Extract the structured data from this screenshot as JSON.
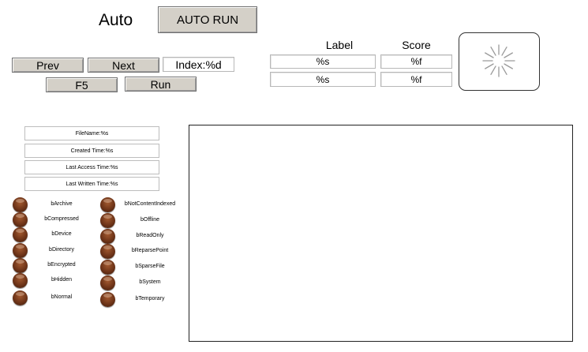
{
  "header": {
    "mode_title": "Auto",
    "auto_run_label": "AUTO RUN"
  },
  "nav": {
    "prev_label": "Prev",
    "next_label": "Next",
    "index_value": "Index:%d",
    "f5_label": "F5",
    "run_label": "Run"
  },
  "results": {
    "label_header": "Label",
    "score_header": "Score",
    "rows": [
      {
        "label": "%s",
        "score": "%f"
      },
      {
        "label": "%s",
        "score": "%f"
      }
    ]
  },
  "file_info": {
    "file_name": "FileName:%s",
    "created_time": "Created Time:%s",
    "last_access_time": "Last Access Time:%s",
    "last_written_time": "Last Written Time:%s"
  },
  "attributes": {
    "left": [
      "bArchive",
      "bCompressed",
      "bDevice",
      "bDirectory",
      "bEncrypted",
      "bHidden",
      "bNormal"
    ],
    "right": [
      "bNotContentIndexed",
      "bOffline",
      "bReadOnly",
      "bReparsePoint",
      "bSparseFile",
      "bSystem",
      "bTemporary"
    ]
  },
  "colors": {
    "button_face": "#d4d0c8",
    "led": "#6e3418"
  }
}
